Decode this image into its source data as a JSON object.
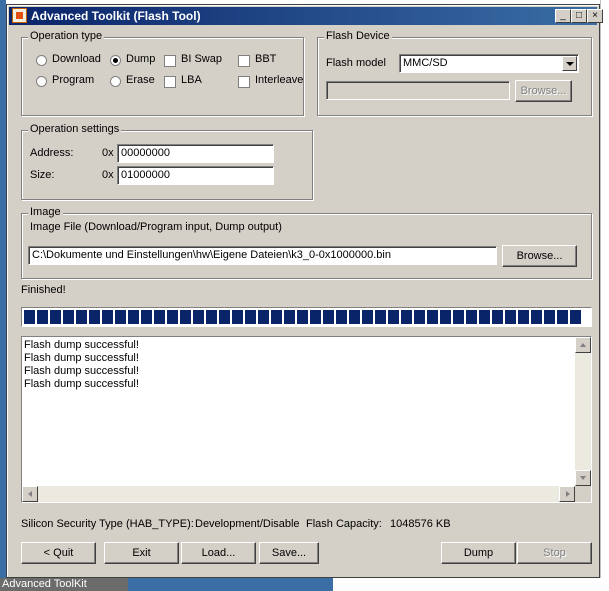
{
  "window": {
    "title": "Advanced Toolkit (Flash Tool)",
    "minimize": "_",
    "maximize": "□",
    "close": "×"
  },
  "taskbar_label": "Advanced ToolKit",
  "operation_type": {
    "label": "Operation type",
    "options": [
      {
        "label": "Download",
        "selected": false
      },
      {
        "label": "Dump",
        "selected": true
      },
      {
        "label": "Program",
        "selected": false
      },
      {
        "label": "Erase",
        "selected": false
      }
    ],
    "checks": [
      {
        "label": "BI Swap",
        "checked": false
      },
      {
        "label": "BBT",
        "checked": false
      },
      {
        "label": "LBA",
        "checked": false
      },
      {
        "label": "Interleave",
        "checked": false
      }
    ]
  },
  "flash_device": {
    "label": "Flash Device",
    "model_label": "Flash model",
    "model_value": "MMC/SD",
    "path_value": "",
    "browse_label": "Browse..."
  },
  "operation_settings": {
    "label": "Operation settings",
    "address_label": "Address:",
    "address_prefix": "0x",
    "address_value": "00000000",
    "size_label": "Size:",
    "size_prefix": "0x",
    "size_value": "01000000"
  },
  "image": {
    "label": "Image",
    "description": "Image File (Download/Program input, Dump output)",
    "path": "C:\\Dokumente und Einstellungen\\hw\\Eigene Dateien\\k3_0-0x1000000.bin",
    "browse_label": "Browse..."
  },
  "status": {
    "text": "Finished!",
    "progress": 1.0
  },
  "log": [
    "Flash dump successful!",
    "Flash dump successful!",
    "Flash dump successful!",
    "Flash dump successful!"
  ],
  "info": {
    "security_label": "Silicon Security Type (HAB_TYPE):",
    "security_value": "Development/Disable",
    "capacity_label": "Flash Capacity:",
    "capacity_value": "1048576 KB"
  },
  "buttons": {
    "quit": "< Quit",
    "exit": "Exit",
    "load": "Load...",
    "save": "Save...",
    "dump": "Dump",
    "stop": "Stop"
  },
  "colors": {
    "titlebar": "#0a246a",
    "progress": "#0a246a",
    "face": "#d4d0c8"
  }
}
